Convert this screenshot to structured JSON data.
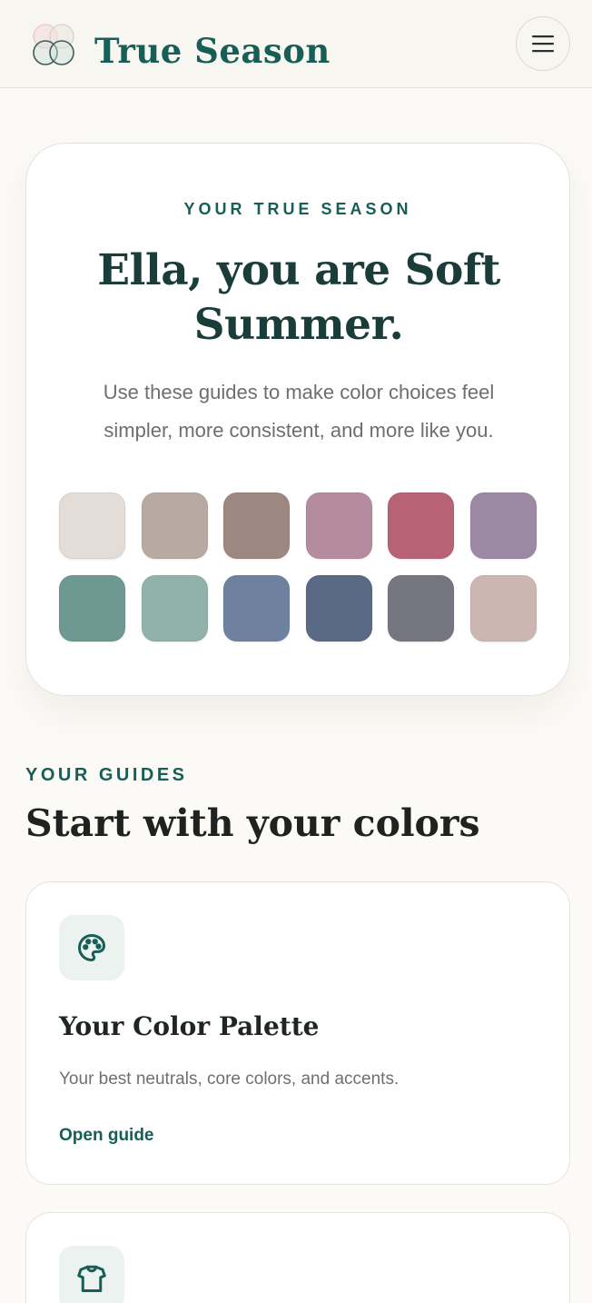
{
  "header": {
    "brand": "True Season",
    "logo_icon": "overlapping-circles-logo",
    "menu_icon": "hamburger-menu-icon"
  },
  "hero": {
    "eyebrow": "YOUR TRUE SEASON",
    "title": "Ella, you are Soft Summer.",
    "subtitle": "Use these guides to make color choices feel simpler, more consistent, and more like you.",
    "swatches": [
      "#e4dcd6",
      "#b8aaa2",
      "#9c8880",
      "#b48c9e",
      "#b86276",
      "#9c8aa4",
      "#6e9892",
      "#90b2aa",
      "#6e82a0",
      "#5a6a86",
      "#767680",
      "#ccb6b2"
    ]
  },
  "guides": {
    "eyebrow": "YOUR GUIDES",
    "title": "Start with your colors",
    "cards": [
      {
        "icon": "palette-icon",
        "title": "Your Color Palette",
        "description": "Your best neutrals, core colors, and accents.",
        "link": "Open guide"
      },
      {
        "icon": "tshirt-icon"
      }
    ]
  },
  "colors": {
    "accent": "#175e57",
    "background": "#fbfaf6",
    "card": "#ffffff",
    "icon_tile": "#ebf2f0"
  }
}
